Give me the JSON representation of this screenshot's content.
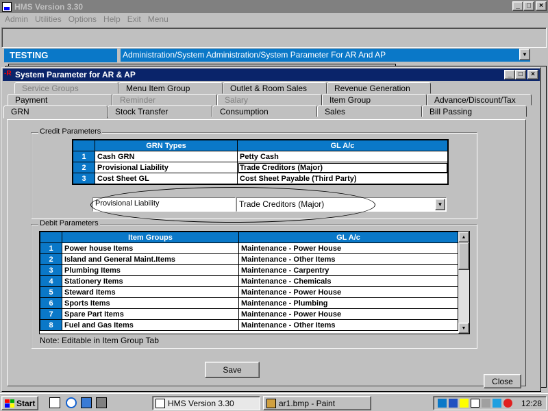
{
  "app": {
    "title": "HMS Version 3.30",
    "menu": [
      "Admin",
      "Utilities",
      "Options",
      "Help",
      "Exit",
      "Menu"
    ],
    "min": "_",
    "max": "□",
    "close": "×"
  },
  "context": {
    "label": "TESTING",
    "path": "Administration/System Administration/System Parameter For AR And AP"
  },
  "window": {
    "title": "System Parameter for AR & AP",
    "tabs_row1": [
      "Service Groups",
      "Menu Item Group",
      "Outlet & Room Sales",
      "Revenue Generation"
    ],
    "tabs_row2": [
      "Payment",
      "Reminder",
      "Salary",
      "Item Group",
      "Advance/Discount/Tax"
    ],
    "tabs_row3": [
      "GRN",
      "Stock Transfer",
      "Consumption",
      "Sales",
      "Bill Passing"
    ],
    "active_tab": "GRN"
  },
  "credit": {
    "label": "Credit Parameters",
    "headers": [
      "GRN Types",
      "GL A/c"
    ],
    "rows": [
      {
        "num": "1",
        "type": "Cash GRN",
        "gl": "Petty Cash"
      },
      {
        "num": "2",
        "type": "Provisional Liability",
        "gl": "Trade Creditors (Major)"
      },
      {
        "num": "3",
        "type": "Cost Sheet GL",
        "gl": "Cost Sheet Payable (Third Party)"
      }
    ],
    "edit_type": "Provisional Liability",
    "edit_gl": "Trade Creditors (Major)"
  },
  "debit": {
    "label": "Debit Parameters",
    "headers": [
      "Item Groups",
      "GL A/c"
    ],
    "rows": [
      {
        "num": "1",
        "group": "Power house Items",
        "gl": "Maintenance - Power House"
      },
      {
        "num": "2",
        "group": "Island and General Maint.Items",
        "gl": "Maintenance - Other Items"
      },
      {
        "num": "3",
        "group": "Plumbing Items",
        "gl": "Maintenance - Carpentry"
      },
      {
        "num": "4",
        "group": "Stationery Items",
        "gl": "Maintenance - Chemicals"
      },
      {
        "num": "5",
        "group": "Steward Items",
        "gl": "Maintenance - Power House"
      },
      {
        "num": "6",
        "group": "Sports Items",
        "gl": "Maintenance - Plumbing"
      },
      {
        "num": "7",
        "group": "Spare Part Items",
        "gl": "Maintenance - Power House"
      },
      {
        "num": "8",
        "group": "Fuel and Gas Items",
        "gl": "Maintenance - Other Items"
      }
    ],
    "note": "Note: Editable in Item Group Tab"
  },
  "buttons": {
    "save": "Save",
    "close": "Close"
  },
  "taskbar": {
    "start": "Start",
    "tasks": [
      "HMS Version 3.30",
      "ar1.bmp - Paint"
    ],
    "clock": "12:28"
  },
  "colors": {
    "accent": "#0a78c8",
    "title_active": "#0a246a",
    "face": "#c0c0c0"
  }
}
